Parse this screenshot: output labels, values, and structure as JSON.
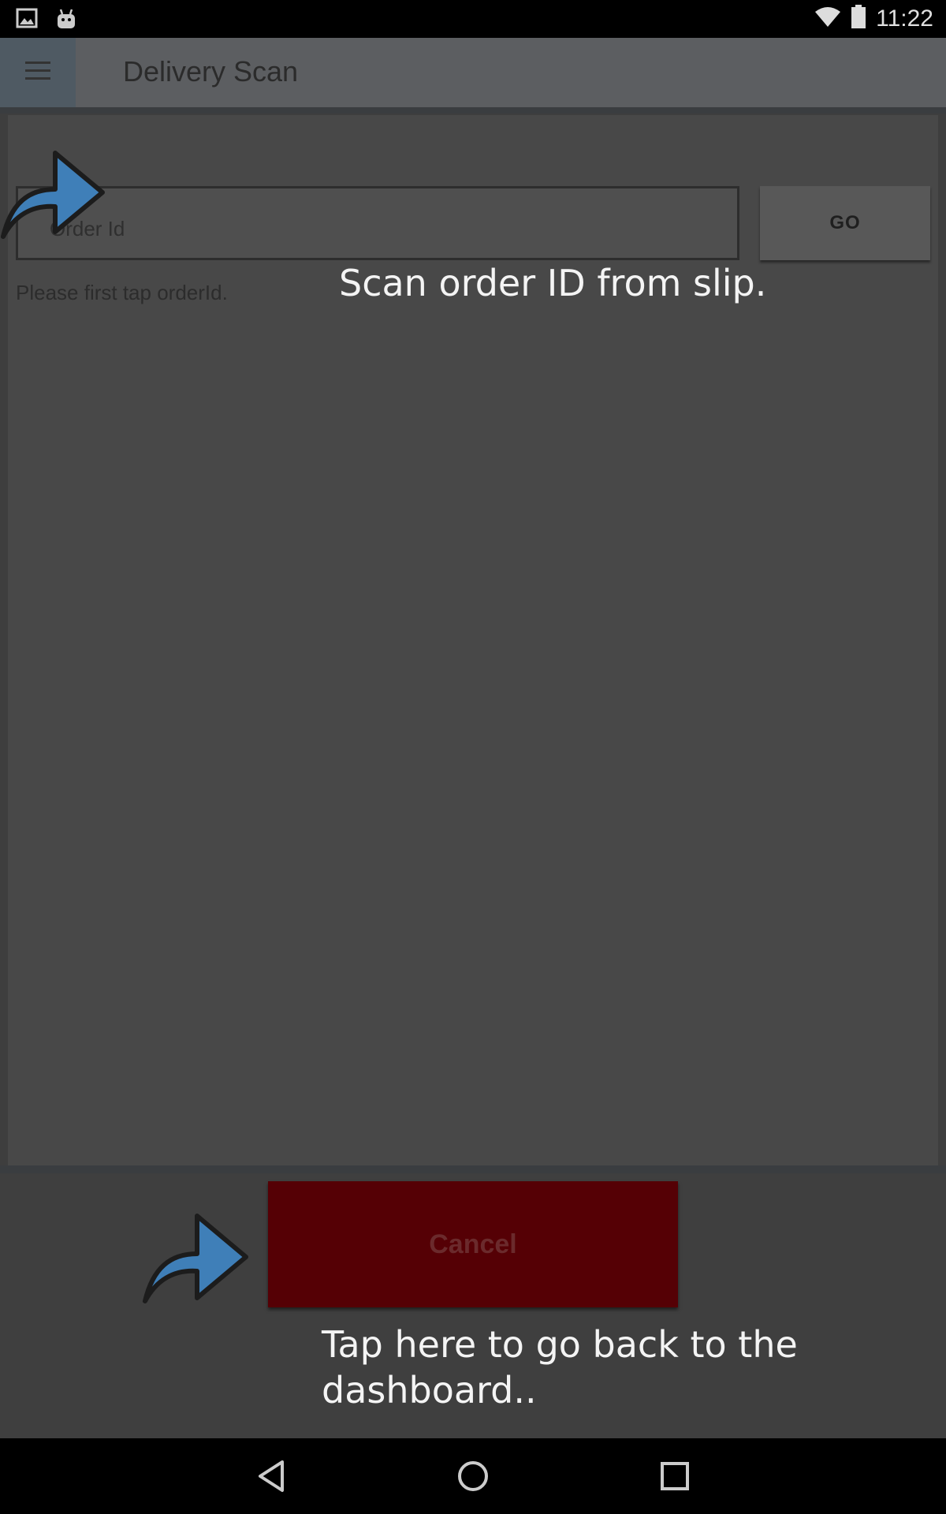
{
  "status_bar": {
    "time": "11:22",
    "icons": [
      "image-icon",
      "android-icon",
      "wifi-icon",
      "battery-icon"
    ]
  },
  "app_bar": {
    "title": "Delivery Scan",
    "menu_icon": "hamburger-menu-icon"
  },
  "scan_form": {
    "order_placeholder": "Order Id",
    "go_label": "GO",
    "hint": "Please first tap orderId."
  },
  "tutorial": {
    "scan_tip": "Scan order ID from slip.",
    "cancel_tip_line1": "Tap here to go back to the",
    "cancel_tip_line2": "dashboard..",
    "arrow_color": "#3f7fb8"
  },
  "footer": {
    "cancel_label": "Cancel",
    "cancel_color": "#550005"
  },
  "nav_bar": {
    "icons": [
      "back-icon",
      "home-icon",
      "recents-icon"
    ]
  }
}
